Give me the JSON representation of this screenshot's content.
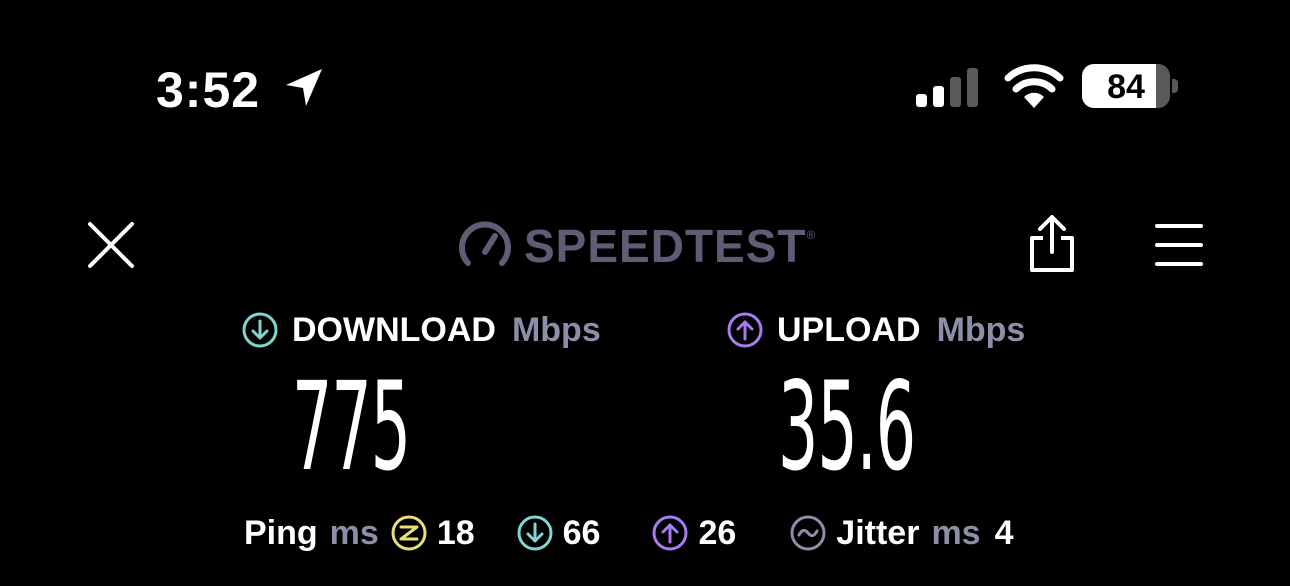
{
  "status_bar": {
    "time": "3:52",
    "battery_level": "84",
    "battery_percent": 84,
    "icons": [
      "location-arrow-icon",
      "cellular-signal-icon",
      "wifi-icon",
      "battery-icon"
    ]
  },
  "toolbar": {
    "close_icon": "close-icon",
    "logo_text": "SPEEDTEST",
    "logo_mark": "®",
    "share_icon": "share-icon",
    "menu_icon": "hamburger-menu-icon"
  },
  "download": {
    "label": "DOWNLOAD",
    "unit": "Mbps",
    "value": "775",
    "color": "#7fd6d0"
  },
  "upload": {
    "label": "UPLOAD",
    "unit": "Mbps",
    "value": "35.6",
    "color": "#a77cf0"
  },
  "stats": {
    "ping_label": "Ping",
    "ping_unit": "ms",
    "idle_ping": "18",
    "idle_color": "#e8de7a",
    "download_ping": "66",
    "download_color": "#7fd6d0",
    "upload_ping": "26",
    "upload_color": "#a77cf0",
    "jitter_label": "Jitter",
    "jitter_unit": "ms",
    "jitter": "4",
    "jitter_color": "#8d8ea8"
  },
  "colors": {
    "background": "#000000",
    "logo": "#5d5e76",
    "unit_text": "#8d8ea8"
  }
}
